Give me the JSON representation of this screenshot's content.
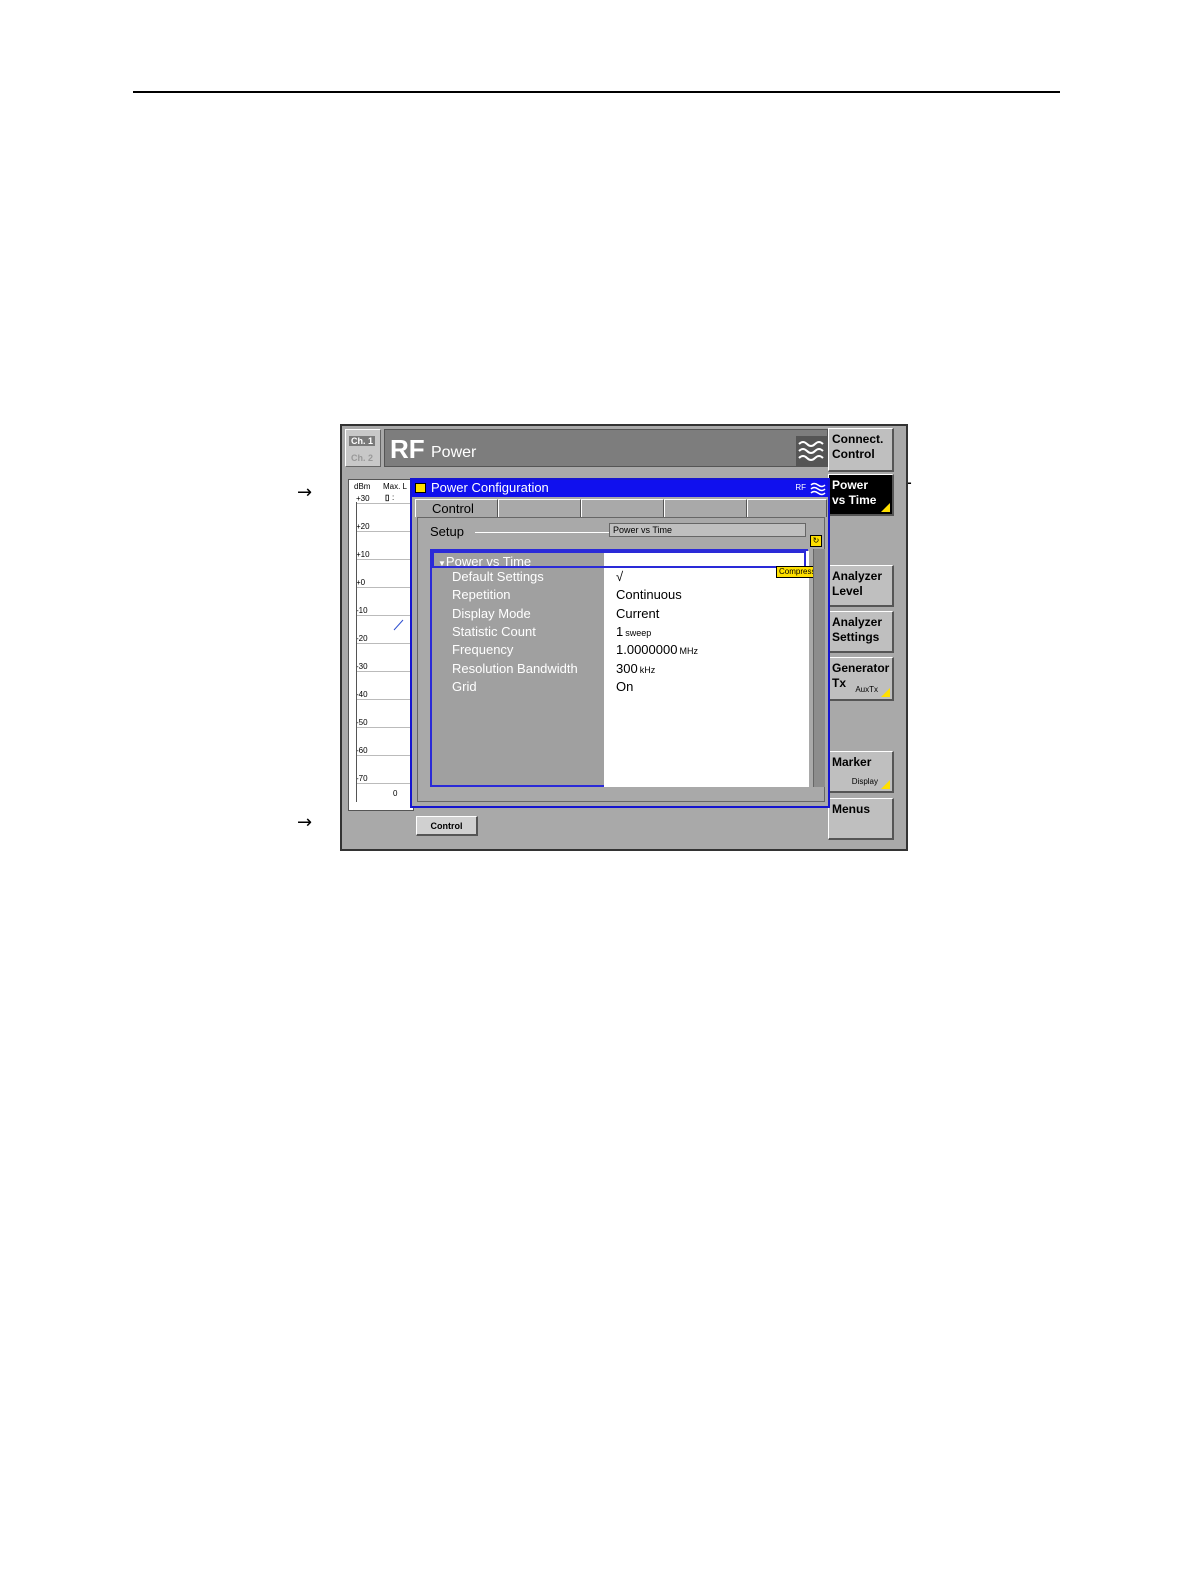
{
  "header": {
    "channel_1": "Ch. 1",
    "channel_2": "Ch. 2",
    "app": "RF",
    "title": "Power"
  },
  "softkeys": [
    {
      "label1": "Connect.",
      "label2": "Control",
      "sub": "",
      "active": false
    },
    {
      "label1": "Power",
      "label2": "vs Time",
      "sub": "",
      "active": true
    },
    {
      "label1": "Analyzer",
      "label2": "Level",
      "sub": "",
      "active": false
    },
    {
      "label1": "Analyzer",
      "label2": "Settings",
      "sub": "",
      "active": false
    },
    {
      "label1": "Generator",
      "label2": "Tx",
      "sub": "AuxTx",
      "active": false
    },
    {
      "label1": "Marker",
      "label2": "",
      "sub": "Display",
      "active": false
    },
    {
      "label1": "Menus",
      "label2": "",
      "sub": "",
      "active": false
    }
  ],
  "graph": {
    "unit": "dBm",
    "mode": "Max. L",
    "marker": ":",
    "ticks": [
      "+30",
      "+20",
      "+10",
      "+0",
      "-10",
      "-20",
      "-30",
      "-40",
      "-50",
      "-60",
      "-70"
    ],
    "x_start": "0"
  },
  "dialog": {
    "title": "Power Configuration",
    "rf_label": "RF",
    "tabs": [
      "Control",
      "",
      "",
      "",
      ""
    ],
    "group": "Setup",
    "group_field": "Power vs Time",
    "compress": "Compress",
    "tree_header": "Power vs Time",
    "rows": [
      {
        "label": "Default Settings",
        "value": "√",
        "unit": ""
      },
      {
        "label": "Repetition",
        "value": "Continuous",
        "unit": ""
      },
      {
        "label": "Display Mode",
        "value": "Current",
        "unit": ""
      },
      {
        "label": "Statistic Count",
        "value": "1",
        "unit": "sweep"
      },
      {
        "label": "Frequency",
        "value": "1.0000000",
        "unit": "MHz"
      },
      {
        "label": "Resolution Bandwidth",
        "value": "300",
        "unit": "kHz"
      },
      {
        "label": "Grid",
        "value": "On",
        "unit": ""
      }
    ]
  },
  "bottom": {
    "control_button": "Control"
  },
  "colors": {
    "dialog_title": "#1010ee",
    "selection": "#2a2ad8",
    "accent_yellow": "#ffe000",
    "hand_green": "#1e9e55"
  }
}
